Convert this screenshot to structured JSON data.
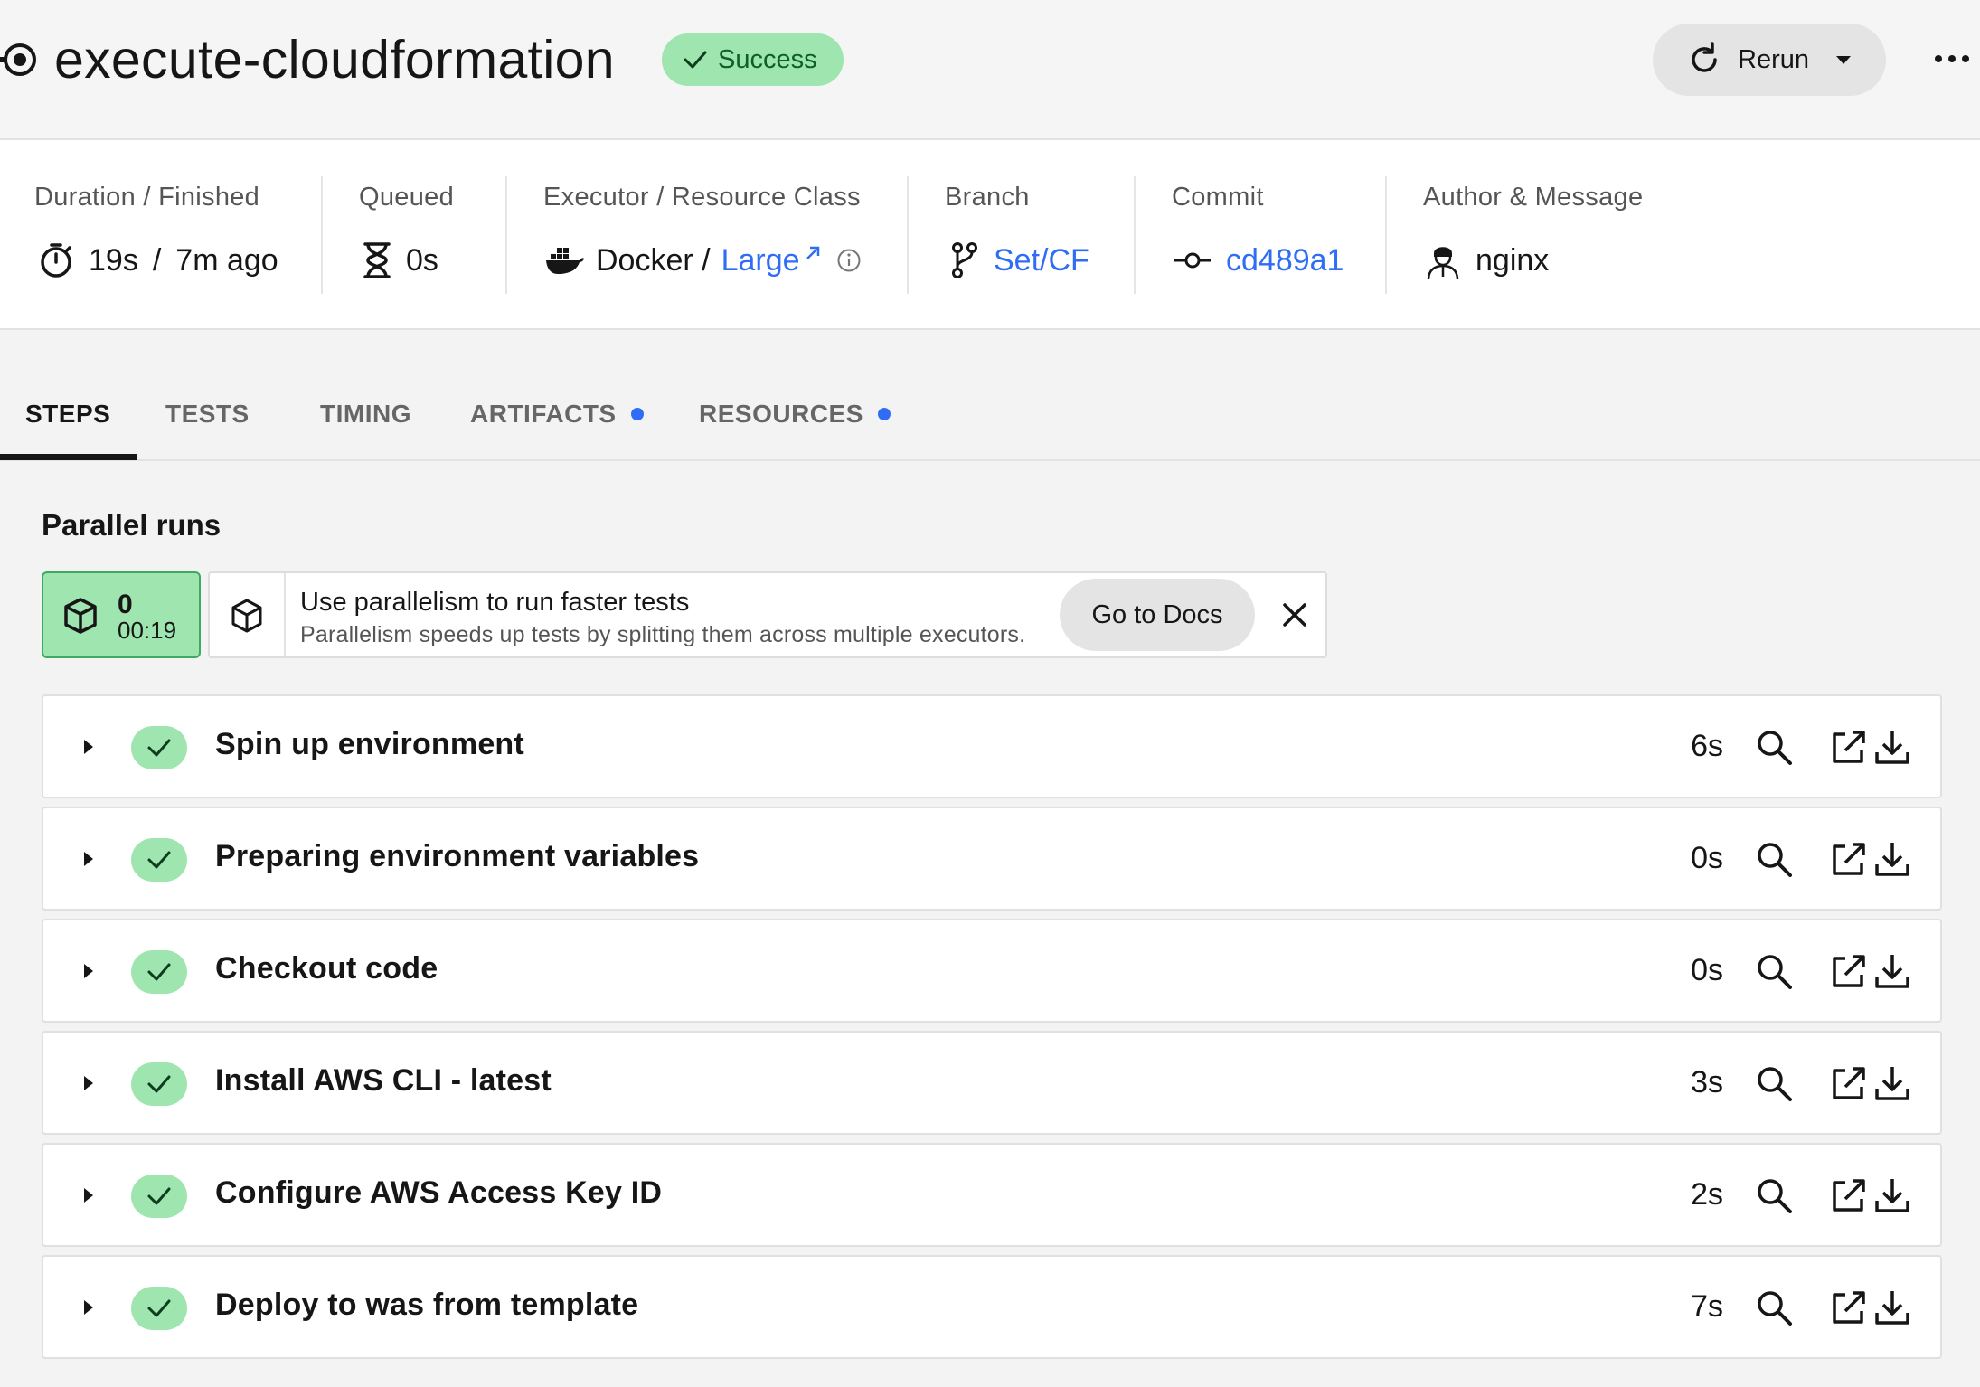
{
  "header": {
    "title": "execute-cloudformation",
    "status": "Success",
    "rerun_label": "Rerun"
  },
  "meta": {
    "duration": {
      "label": "Duration / Finished",
      "duration": "19s",
      "separator": "/",
      "finished": "7m ago"
    },
    "queued": {
      "label": "Queued",
      "value": "0s"
    },
    "executor": {
      "label": "Executor / Resource Class",
      "executor": "Docker /",
      "resource_class": "Large"
    },
    "branch": {
      "label": "Branch",
      "value": "Set/CF"
    },
    "commit": {
      "label": "Commit",
      "value": "cd489a1"
    },
    "author": {
      "label": "Author & Message",
      "value": "nginx"
    }
  },
  "tabs": [
    {
      "label": "STEPS",
      "active": true,
      "dot": false
    },
    {
      "label": "TESTS",
      "active": false,
      "dot": false
    },
    {
      "label": "TIMING",
      "active": false,
      "dot": false
    },
    {
      "label": "ARTIFACTS",
      "active": false,
      "dot": true
    },
    {
      "label": "RESOURCES",
      "active": false,
      "dot": true
    }
  ],
  "parallel": {
    "title": "Parallel runs",
    "run": {
      "index": "0",
      "time": "00:19"
    },
    "tip": {
      "title": "Use parallelism to run faster tests",
      "subtitle": "Parallelism speeds up tests by splitting them across multiple executors.",
      "button": "Go to Docs"
    }
  },
  "steps": [
    {
      "name": "Spin up environment",
      "duration": "6s"
    },
    {
      "name": "Preparing environment variables",
      "duration": "0s"
    },
    {
      "name": "Checkout code",
      "duration": "0s"
    },
    {
      "name": "Install AWS CLI - latest",
      "duration": "3s"
    },
    {
      "name": "Configure AWS Access Key ID",
      "duration": "2s"
    },
    {
      "name": "Deploy to was from template",
      "duration": "7s"
    }
  ],
  "colors": {
    "success_bg": "#9ee5b0",
    "link": "#2f6df6",
    "dot": "#2f6df6"
  },
  "icons": {
    "job": "job-status-icon",
    "status": "check-icon",
    "rerun": "refresh-icon",
    "more": "more-dots-icon",
    "duration": "stopwatch-icon",
    "queued": "hourglass-icon",
    "executor": "docker-icon",
    "branch": "git-branch-icon",
    "commit": "git-commit-icon",
    "author": "user-avatar-icon",
    "step_actions": [
      "search-icon",
      "open-external-icon",
      "download-icon"
    ]
  }
}
